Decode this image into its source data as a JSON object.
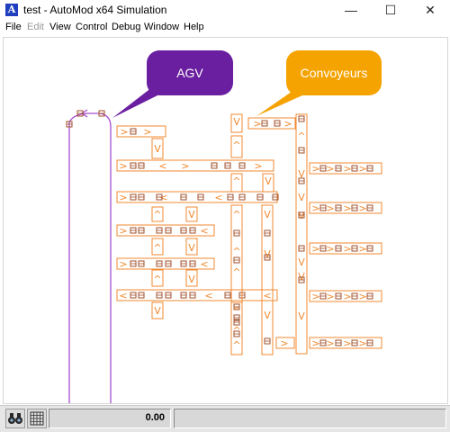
{
  "window": {
    "app_icon_letter": "A",
    "title": "test - AutoMod x64 Simulation",
    "minimize_glyph": "—",
    "maximize_glyph": "☐",
    "close_glyph": "✕"
  },
  "menu": {
    "file": "File",
    "edit": "Edit",
    "view": "View",
    "control": "Control",
    "debug": "Debug",
    "window": "Window",
    "help": "Help"
  },
  "callouts": {
    "agv": "AGV",
    "conveyors": "Convoyeurs"
  },
  "colors": {
    "agv_purple": "#6a1fa0",
    "agv_path": "#a64dcf",
    "conveyor_orange": "#f08a30",
    "callout_orange": "#f5a300"
  },
  "statusbar": {
    "tool1_icon": "binoculars-icon",
    "tool2_icon": "grid-icon",
    "clock_value": "0.00"
  }
}
